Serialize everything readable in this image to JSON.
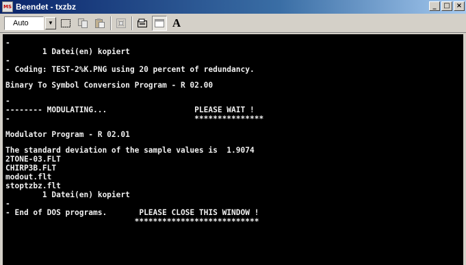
{
  "window": {
    "title": "Beendet - txzbz",
    "icon_name": "ms-dos-icon",
    "icon_text": "MS",
    "controls": {
      "minimize": "_",
      "maximize": "□",
      "close": "×"
    }
  },
  "toolbar": {
    "font_size_value": "Auto",
    "dropdown_arrow": "▼",
    "font_button_label": "A",
    "buttons": [
      "mark-icon",
      "copy-icon",
      "paste-icon",
      "fullscreen-icon",
      "properties-icon",
      "background-icon",
      "font-icon"
    ]
  },
  "console": {
    "lines": [
      "-",
      "        1 Datei(en) kopiert",
      "-",
      "- Coding: TEST-2%K.PNG using 20 percent of redundancy.",
      "",
      "Binary To Symbol Conversion Program - R 02.00",
      "",
      "-",
      "-------- MODULATING...                   PLEASE WAIT !",
      "-                                        ***************",
      "",
      "Modulator Program - R 02.01",
      "",
      "The standard deviation of the sample values is  1.9074",
      "2TONE-03.FLT",
      "CHIRP3B.FLT",
      "modout.flt",
      "stoptzbz.flt",
      "        1 Datei(en) kopiert",
      "-",
      "- End of DOS programs.       PLEASE CLOSE THIS WINDOW !",
      "                            ***************************"
    ]
  },
  "colors": {
    "console_background": "#000000",
    "console_text": "#f0f0f0",
    "titlebar_start": "#0a246a",
    "titlebar_end": "#a6caf0",
    "chrome": "#d4d0c8"
  }
}
